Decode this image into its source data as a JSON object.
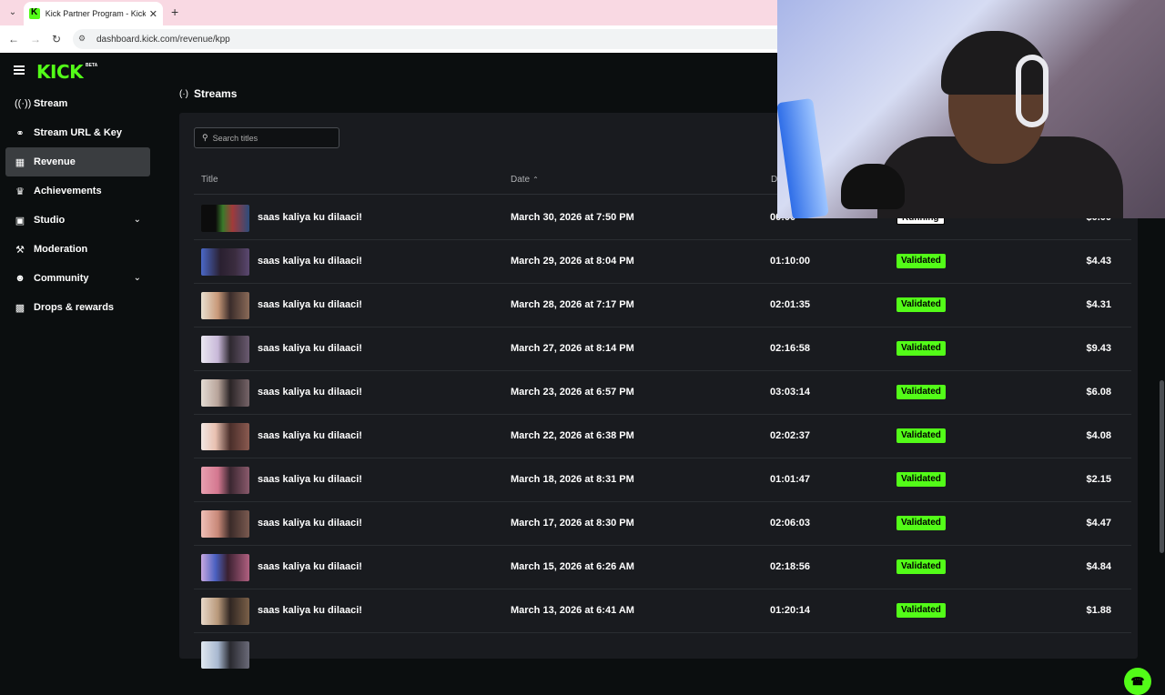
{
  "browser": {
    "tab_title": "Kick Partner Program - Kick Dashboard",
    "url": "dashboard.kick.com/revenue/kpp"
  },
  "app": {
    "logo": "KICK",
    "logo_badge": "BETA"
  },
  "sidebar": {
    "items": [
      {
        "label": "Stream",
        "icon": "broadcast-icon"
      },
      {
        "label": "Stream URL & Key",
        "icon": "link-icon"
      },
      {
        "label": "Revenue",
        "icon": "revenue-icon",
        "active": true
      },
      {
        "label": "Achievements",
        "icon": "trophy-icon"
      },
      {
        "label": "Studio",
        "icon": "studio-icon",
        "expandable": true
      },
      {
        "label": "Moderation",
        "icon": "wrench-icon"
      },
      {
        "label": "Community",
        "icon": "community-icon",
        "expandable": true
      },
      {
        "label": "Drops & rewards",
        "icon": "drops-icon"
      }
    ]
  },
  "section": {
    "title": "Streams"
  },
  "search": {
    "placeholder": "Search titles"
  },
  "table": {
    "headers": {
      "title": "Title",
      "date": "Date",
      "duration": "D"
    },
    "rows": [
      {
        "title": "saas kaliya ku dilaaci!",
        "date": "March 30, 2026 at 7:50 PM",
        "duration": "00:00",
        "status": "Running",
        "amount": "$0.00"
      },
      {
        "title": "saas kaliya ku dilaaci!",
        "date": "March 29, 2026 at 8:04 PM",
        "duration": "01:10:00",
        "status": "Validated",
        "amount": "$4.43"
      },
      {
        "title": "saas kaliya ku dilaaci!",
        "date": "March 28, 2026 at 7:17 PM",
        "duration": "02:01:35",
        "status": "Validated",
        "amount": "$4.31"
      },
      {
        "title": "saas kaliya ku dilaaci!",
        "date": "March 27, 2026 at 8:14 PM",
        "duration": "02:16:58",
        "status": "Validated",
        "amount": "$9.43"
      },
      {
        "title": "saas kaliya ku dilaaci!",
        "date": "March 23, 2026 at 6:57 PM",
        "duration": "03:03:14",
        "status": "Validated",
        "amount": "$6.08"
      },
      {
        "title": "saas kaliya ku dilaaci!",
        "date": "March 22, 2026 at 6:38 PM",
        "duration": "02:02:37",
        "status": "Validated",
        "amount": "$4.08"
      },
      {
        "title": "saas kaliya ku dilaaci!",
        "date": "March 18, 2026 at 8:31 PM",
        "duration": "01:01:47",
        "status": "Validated",
        "amount": "$2.15"
      },
      {
        "title": "saas kaliya ku dilaaci!",
        "date": "March 17, 2026 at 8:30 PM",
        "duration": "02:06:03",
        "status": "Validated",
        "amount": "$4.47"
      },
      {
        "title": "saas kaliya ku dilaaci!",
        "date": "March 15, 2026 at 6:26 AM",
        "duration": "02:18:56",
        "status": "Validated",
        "amount": "$4.84"
      },
      {
        "title": "saas kaliya ku dilaaci!",
        "date": "March 13, 2026 at 6:41 AM",
        "duration": "01:20:14",
        "status": "Validated",
        "amount": "$1.88"
      }
    ]
  },
  "colors": {
    "accent": "#53fc18",
    "panel": "#191b1f",
    "background": "#0b0e0f"
  }
}
